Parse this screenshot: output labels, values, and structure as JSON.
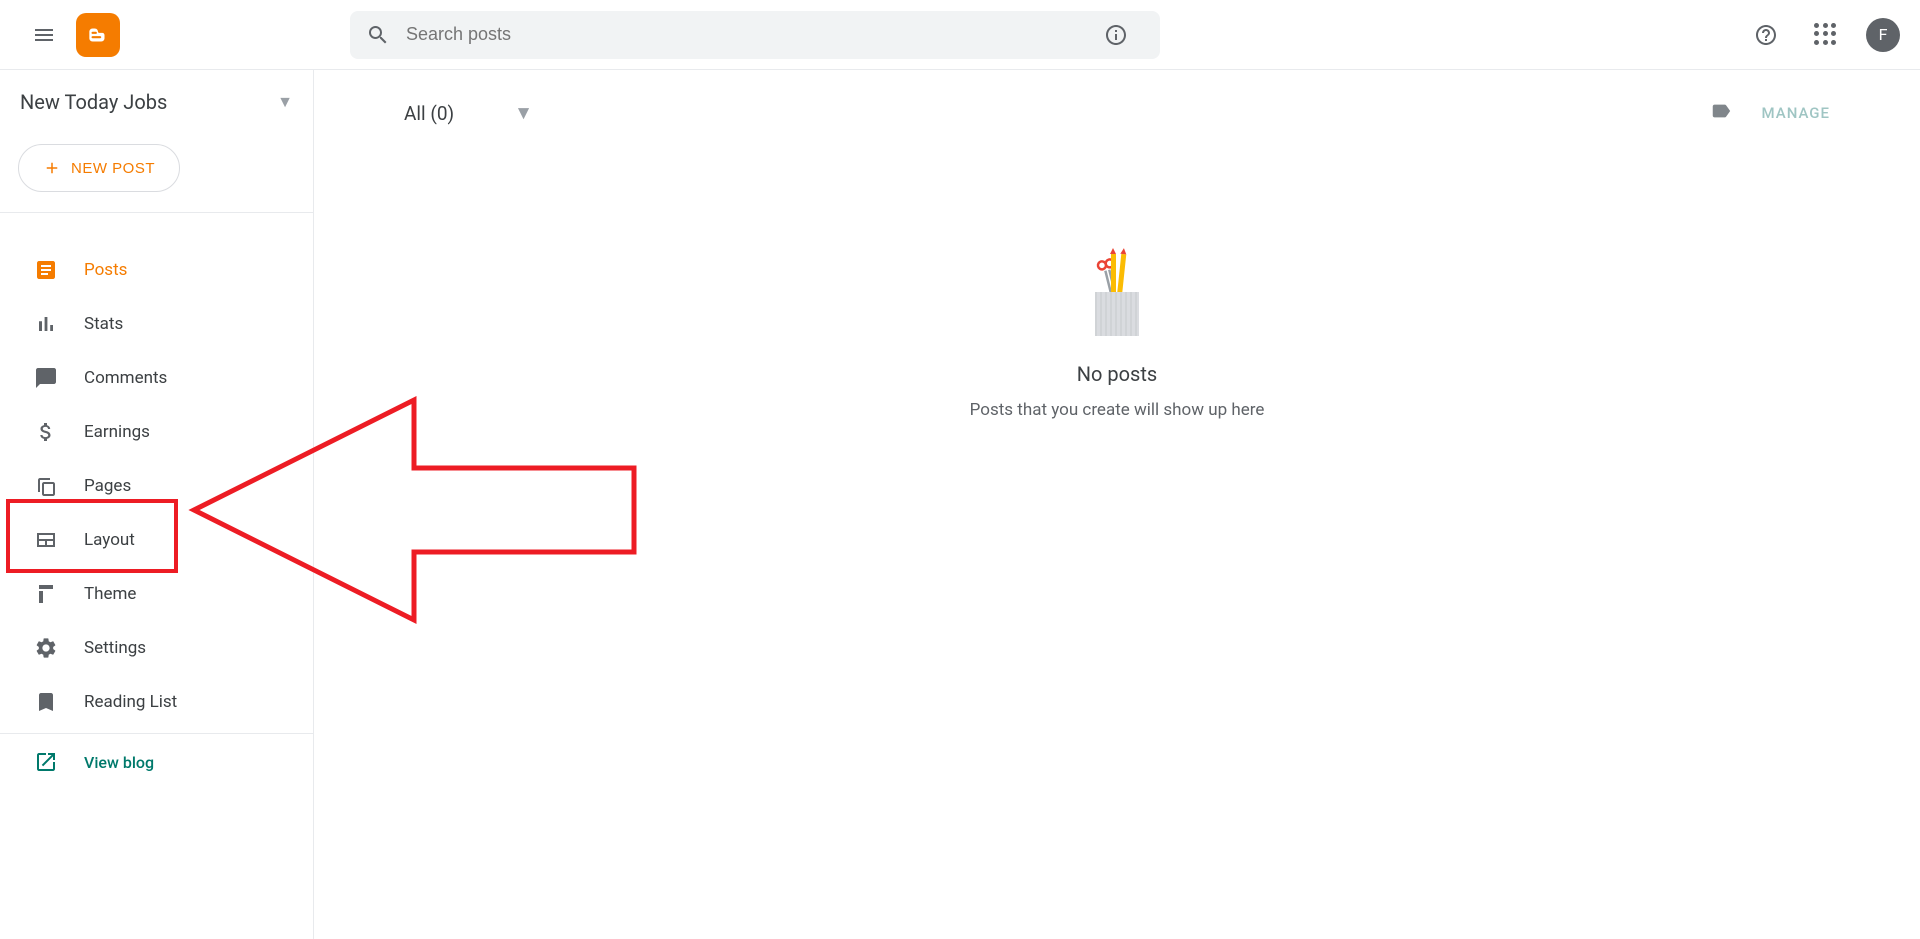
{
  "header": {
    "search_placeholder": "Search posts",
    "avatar_initial": "F"
  },
  "sidebar": {
    "blog_name": "New Today Jobs",
    "new_post_label": "NEW POST",
    "nav": [
      {
        "label": "Posts"
      },
      {
        "label": "Stats"
      },
      {
        "label": "Comments"
      },
      {
        "label": "Earnings"
      },
      {
        "label": "Pages"
      },
      {
        "label": "Layout"
      },
      {
        "label": "Theme"
      },
      {
        "label": "Settings"
      },
      {
        "label": "Reading List"
      }
    ],
    "view_blog_label": "View blog"
  },
  "main": {
    "filter_label": "All (0)",
    "manage_label": "MANAGE",
    "empty_title": "No posts",
    "empty_subtitle": "Posts that you create will show up here"
  }
}
